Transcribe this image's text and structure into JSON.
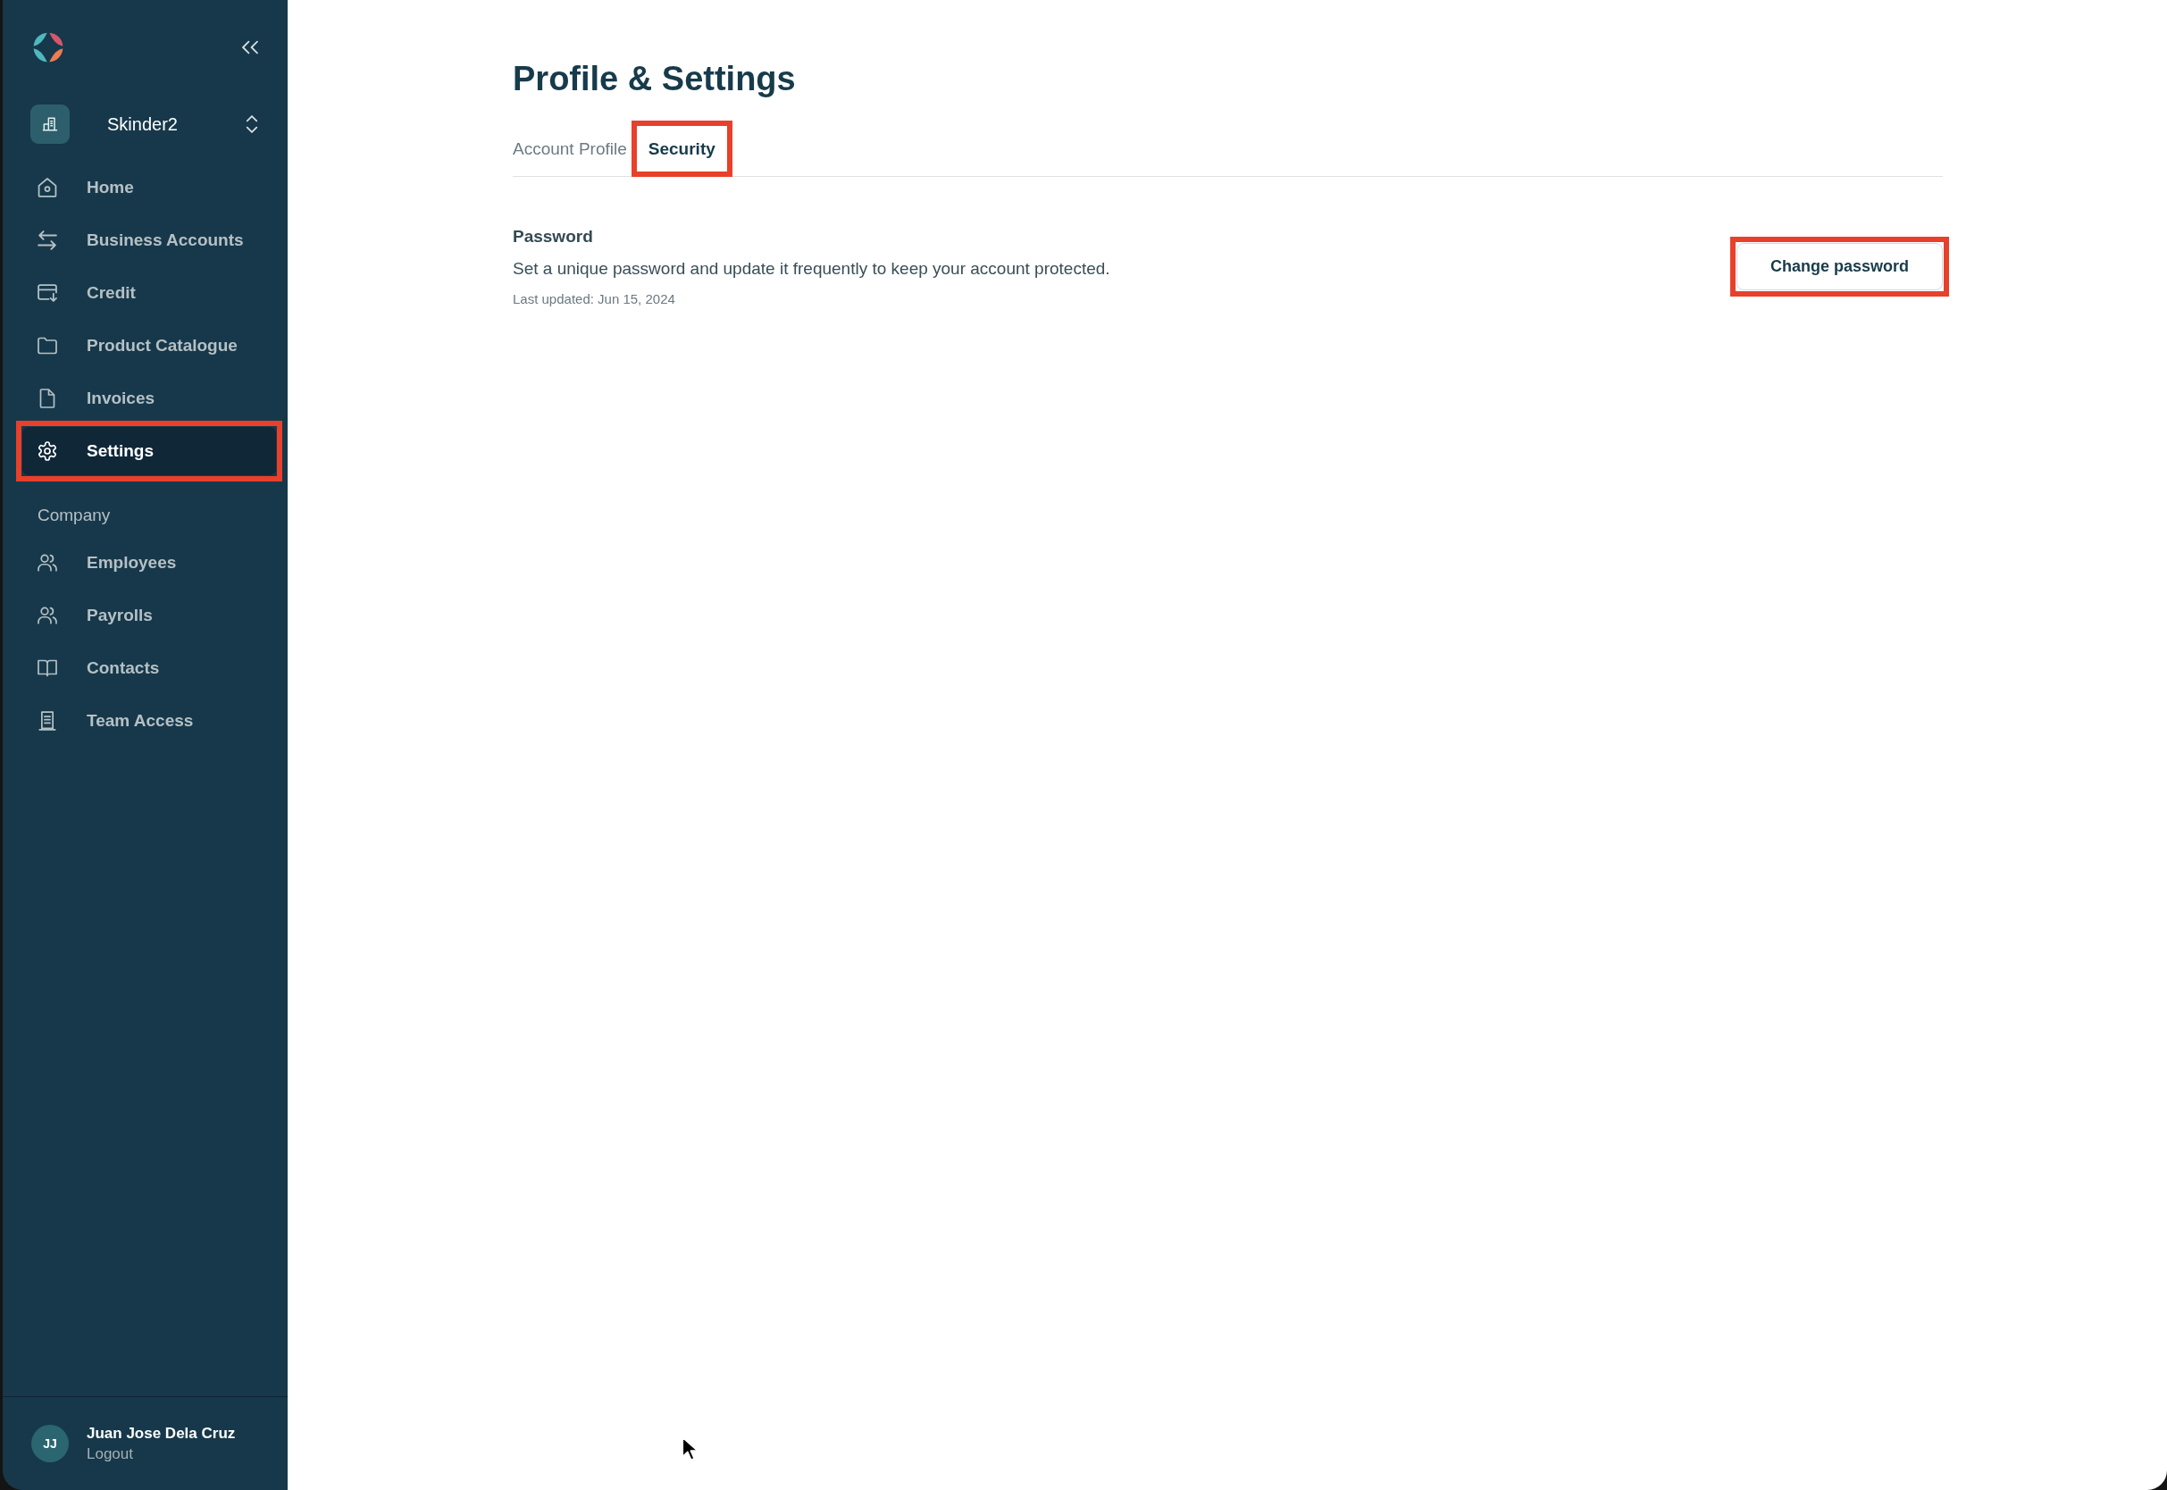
{
  "sidebar": {
    "workspace": "Skinder2",
    "main_nav": [
      {
        "label": "Home",
        "selected": false,
        "highlighted": false
      },
      {
        "label": "Business Accounts",
        "selected": false,
        "highlighted": false
      },
      {
        "label": "Credit",
        "selected": false,
        "highlighted": false
      },
      {
        "label": "Product Catalogue",
        "selected": false,
        "highlighted": false
      },
      {
        "label": "Invoices",
        "selected": false,
        "highlighted": false
      },
      {
        "label": "Settings",
        "selected": true,
        "highlighted": true
      }
    ],
    "section_label": "Company",
    "company_nav": [
      {
        "label": "Employees",
        "selected": false,
        "highlighted": false
      },
      {
        "label": "Payrolls",
        "selected": false,
        "highlighted": false
      },
      {
        "label": "Contacts",
        "selected": false,
        "highlighted": false
      },
      {
        "label": "Team Access",
        "selected": false,
        "highlighted": false
      }
    ],
    "user": {
      "initials": "JJ",
      "name": "Juan Jose Dela Cruz",
      "action": "Logout"
    }
  },
  "page": {
    "title": "Profile & Settings",
    "tabs": [
      {
        "label": "Account Profile",
        "selected": false,
        "highlighted": false
      },
      {
        "label": "Security",
        "selected": true,
        "highlighted": true
      }
    ],
    "password": {
      "heading": "Password",
      "description": "Set a unique password and update it frequently to keep your account protected.",
      "last_updated": "Last updated: Jun 15, 2024",
      "button": {
        "label": "Change password",
        "highlighted": true
      }
    }
  }
}
